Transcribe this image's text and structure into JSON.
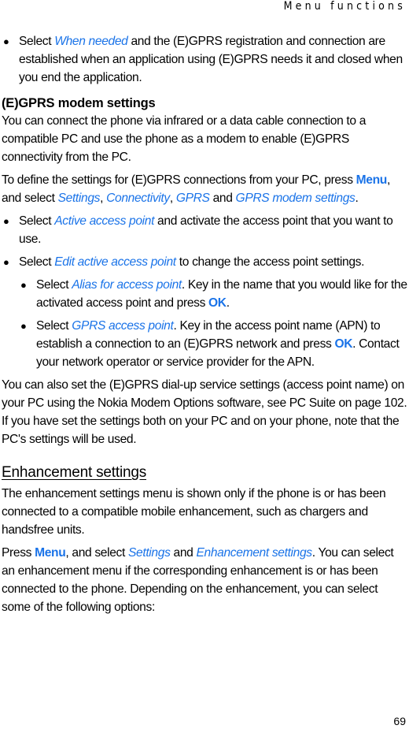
{
  "header": {
    "running_head": "Menu functions"
  },
  "content": {
    "bullet_when_needed": {
      "pre": "Select ",
      "em": "When needed",
      "post": " and the (E)GPRS registration and connection are established when an application using (E)GPRS needs it and closed when you end the application."
    },
    "modem_section": {
      "heading": "(E)GPRS modem settings",
      "para1": "You can connect the phone via infrared or a data cable connection to a compatible PC and use the phone as a modem to enable (E)GPRS connectivity from the PC.",
      "para2": {
        "pre": "To define the settings for (E)GPRS connections from your PC, press ",
        "key_menu": "Menu",
        "mid1": ", and select ",
        "em_settings": "Settings",
        "sep1": ", ",
        "em_connectivity": "Connectivity",
        "sep2": ", ",
        "em_gprs": "GPRS",
        "sep3": " and ",
        "em_gprs_modem": "GPRS modem settings",
        "end": "."
      },
      "bullets": [
        {
          "pre": "Select ",
          "em": "Active access point",
          "post": " and activate the access point that you want to use."
        },
        {
          "pre": "Select ",
          "em": "Edit active access point",
          "post": " to change the access point settings."
        }
      ],
      "sub_bullets": [
        {
          "pre": "Select ",
          "em": "Alias for access point",
          "mid": ". Key in the name that you would like for the activated access point and press ",
          "key": "OK",
          "post": "."
        },
        {
          "pre": "Select ",
          "em": "GPRS access point",
          "mid": ". Key in the access point name (APN) to establish a connection to an (E)GPRS network and press ",
          "key": "OK",
          "post": ". Contact your network operator or service provider for the APN."
        }
      ],
      "para3": "You can also set the (E)GPRS dial-up service settings (access point name) on your PC using the Nokia Modem Options software, see PC Suite on page 102. If you have set the settings both on your PC and on your phone, note that the PC's settings will be used."
    },
    "enhancement_section": {
      "heading": "Enhancement settings",
      "para1": "The enhancement settings menu is shown only if the phone is or has been connected to a compatible mobile enhancement, such as chargers and handsfree units.",
      "para2": {
        "pre": "Press ",
        "key_menu": "Menu",
        "mid1": ", and select ",
        "em_settings": "Settings",
        "sep1": " and ",
        "em_enh": "Enhancement settings",
        "post": ". You can select an enhancement menu if the corresponding enhancement is or has been connected to the phone. Depending on the enhancement, you can select some of the following options:"
      }
    }
  },
  "footer": {
    "page_number": "69"
  },
  "colors": {
    "accent": "#1a73e8",
    "text": "#000000"
  }
}
